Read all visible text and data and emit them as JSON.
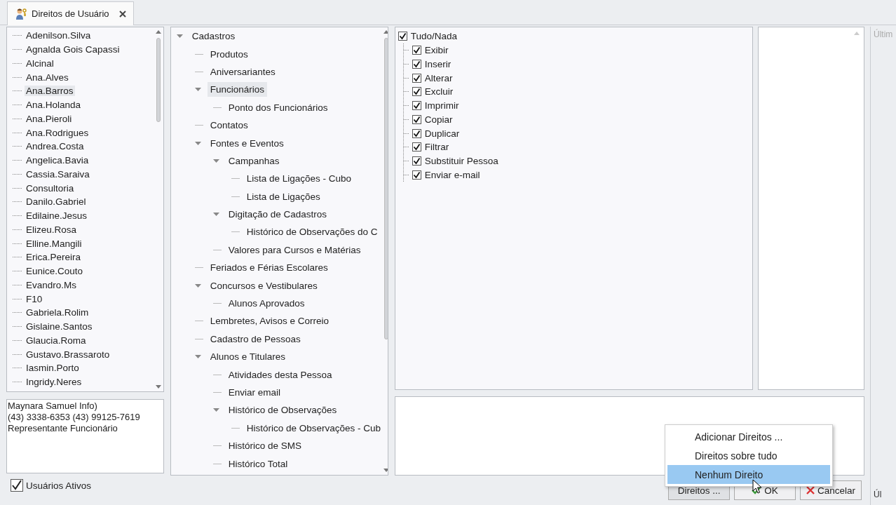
{
  "tab": {
    "title": "Direitos de Usuário",
    "selected": true
  },
  "users": [
    {
      "name": "Adenilson.Silva",
      "selected": false
    },
    {
      "name": "Agnalda Gois Capassi",
      "selected": false
    },
    {
      "name": "Alcinal",
      "selected": false
    },
    {
      "name": "Ana.Alves",
      "selected": false
    },
    {
      "name": "Ana.Barros",
      "selected": true
    },
    {
      "name": "Ana.Holanda",
      "selected": false
    },
    {
      "name": "Ana.Pieroli",
      "selected": false
    },
    {
      "name": "Ana.Rodrigues",
      "selected": false
    },
    {
      "name": "Andrea.Costa",
      "selected": false
    },
    {
      "name": "Angelica.Bavia",
      "selected": false
    },
    {
      "name": "Cassia.Saraiva",
      "selected": false
    },
    {
      "name": "Consultoria",
      "selected": false
    },
    {
      "name": "Danilo.Gabriel",
      "selected": false
    },
    {
      "name": "Edilaine.Jesus",
      "selected": false
    },
    {
      "name": "Elizeu.Rosa",
      "selected": false
    },
    {
      "name": "Elline.Mangili",
      "selected": false
    },
    {
      "name": "Erica.Pereira",
      "selected": false
    },
    {
      "name": "Eunice.Couto",
      "selected": false
    },
    {
      "name": "Evandro.Ms",
      "selected": false
    },
    {
      "name": "F10",
      "selected": false
    },
    {
      "name": "Gabriela.Rolim",
      "selected": false
    },
    {
      "name": "Gislaine.Santos",
      "selected": false
    },
    {
      "name": "Glaucia.Roma",
      "selected": false
    },
    {
      "name": "Gustavo.Brassaroto",
      "selected": false
    },
    {
      "name": "Iasmin.Porto",
      "selected": false
    },
    {
      "name": "Ingridy.Neres",
      "selected": false
    }
  ],
  "user_info": [
    "Maynara Samuel Info)",
    "(43) 3338-6353 (43) 99125-7619",
    "Representante Funcionário"
  ],
  "active_users": {
    "label": "Usuários Ativos",
    "checked": true
  },
  "tree": [
    {
      "label": "Cadastros",
      "expanded": true,
      "selected": false,
      "children": [
        {
          "label": "Produtos",
          "selected": false
        },
        {
          "label": "Aniversariantes",
          "selected": false
        },
        {
          "label": "Funcionários",
          "expanded": true,
          "selected": true,
          "children": [
            {
              "label": "Ponto dos Funcionários",
              "selected": false
            }
          ]
        },
        {
          "label": "Contatos",
          "selected": false
        },
        {
          "label": "Fontes e Eventos",
          "expanded": true,
          "selected": false,
          "children": [
            {
              "label": "Campanhas",
              "expanded": true,
              "selected": false,
              "children": [
                {
                  "label": "Lista de Ligações - Cubo",
                  "selected": false
                },
                {
                  "label": "Lista de Ligações",
                  "selected": false
                }
              ]
            },
            {
              "label": "Digitação de Cadastros",
              "expanded": true,
              "selected": false,
              "children": [
                {
                  "label": "Histórico de Observações do C",
                  "selected": false
                }
              ]
            },
            {
              "label": "Valores para Cursos e Matérias",
              "selected": false
            }
          ]
        },
        {
          "label": "Feriados e Férias Escolares",
          "selected": false
        },
        {
          "label": "Concursos e Vestibulares",
          "expanded": true,
          "selected": false,
          "children": [
            {
              "label": "Alunos Aprovados",
              "selected": false
            }
          ]
        },
        {
          "label": "Lembretes, Avisos e Correio",
          "selected": false
        },
        {
          "label": "Cadastro de Pessoas",
          "selected": false
        },
        {
          "label": "Alunos e Titulares",
          "expanded": true,
          "selected": false,
          "children": [
            {
              "label": "Atividades desta Pessoa",
              "selected": false
            },
            {
              "label": "Enviar email",
              "selected": false
            },
            {
              "label": "Histórico de Observações",
              "expanded": true,
              "selected": false,
              "children": [
                {
                  "label": "Histórico de Observações - Cub",
                  "selected": false
                }
              ]
            },
            {
              "label": "Histórico de SMS",
              "selected": false
            },
            {
              "label": "Histórico Total",
              "selected": false
            }
          ]
        }
      ]
    }
  ],
  "rights": {
    "all": {
      "label": "Tudo/Nada",
      "checked": true
    },
    "items": [
      {
        "label": "Exibir",
        "checked": true
      },
      {
        "label": "Inserir",
        "checked": true
      },
      {
        "label": "Alterar",
        "checked": true
      },
      {
        "label": "Excluir",
        "checked": true
      },
      {
        "label": "Imprimir",
        "checked": true
      },
      {
        "label": "Copiar",
        "checked": true
      },
      {
        "label": "Duplicar",
        "checked": true
      },
      {
        "label": "Filtrar",
        "checked": true
      },
      {
        "label": "Substituir Pessoa",
        "checked": true
      },
      {
        "label": "Enviar e-mail",
        "checked": true
      }
    ]
  },
  "buttons": [
    {
      "label": "Direitos ...",
      "kind": "menu"
    },
    {
      "label": "OK",
      "kind": "ok"
    },
    {
      "label": "Cancelar",
      "kind": "cancel"
    }
  ],
  "menu": [
    {
      "label": "Adicionar Direitos ...",
      "selected": false
    },
    {
      "label": "Direitos sobre tudo",
      "selected": false
    },
    {
      "label": "Nenhum Direito",
      "selected": true
    }
  ],
  "side_panel": {
    "header": "Últim",
    "footer": "Úl"
  }
}
